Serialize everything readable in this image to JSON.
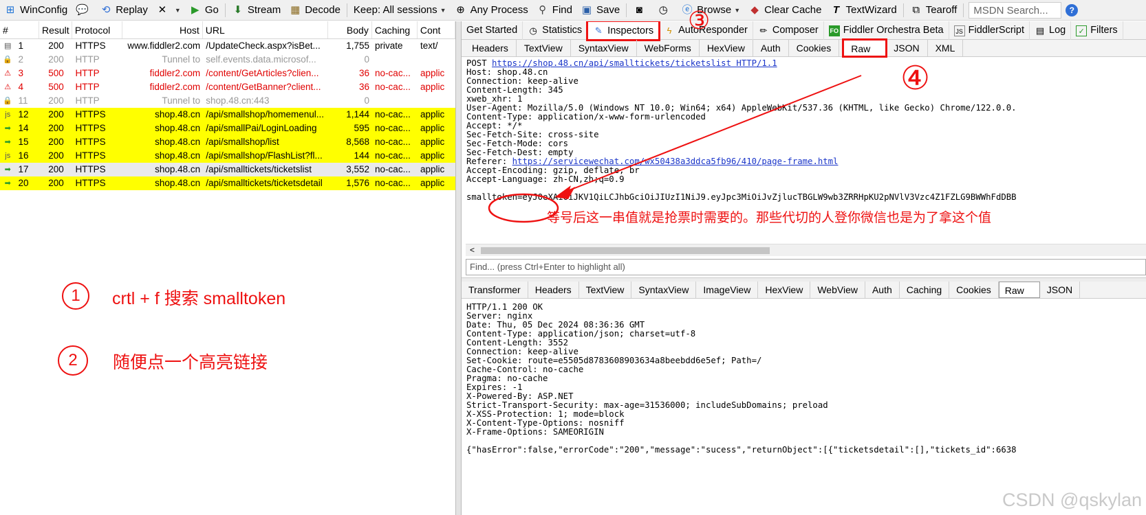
{
  "toolbar": {
    "items": [
      {
        "label": "WinConfig",
        "icon": "windows-icon",
        "dd": false
      },
      {
        "label": "",
        "icon": "comment-icon",
        "dd": false
      },
      {
        "label": "Replay",
        "icon": "replay-icon",
        "dd": false
      },
      {
        "label": "",
        "icon": "remove-icon",
        "dd": true
      },
      {
        "label": "Go",
        "icon": "go-icon",
        "dd": false
      },
      {
        "label": "Stream",
        "icon": "stream-icon",
        "dd": false
      },
      {
        "label": "Decode",
        "icon": "decode-icon",
        "dd": false
      },
      {
        "label": "Keep: All sessions",
        "icon": "",
        "dd": true
      },
      {
        "label": "Any Process",
        "icon": "crosshair-icon",
        "dd": false
      },
      {
        "label": "Find",
        "icon": "binoculars-icon",
        "dd": false
      },
      {
        "label": "Save",
        "icon": "save-icon",
        "dd": false
      },
      {
        "label": "",
        "icon": "camera-icon",
        "dd": false
      },
      {
        "label": "",
        "icon": "timer-icon",
        "dd": false
      },
      {
        "label": "Browse",
        "icon": "ie-icon",
        "dd": true
      },
      {
        "label": "Clear Cache",
        "icon": "eraser-icon",
        "dd": false
      },
      {
        "label": "TextWizard",
        "icon": "text-icon",
        "dd": false
      },
      {
        "label": "Tearoff",
        "icon": "tearoff-icon",
        "dd": false
      }
    ],
    "msdn_placeholder": "MSDN Search..."
  },
  "sessions": {
    "columns": [
      "#",
      "Result",
      "Protocol",
      "Host",
      "URL",
      "Body",
      "Caching",
      "Cont"
    ],
    "rows": [
      {
        "icon": "▤",
        "num": "1",
        "result": "200",
        "protocol": "HTTPS",
        "host": "www.fiddler2.com",
        "url": "/UpdateCheck.aspx?isBet...",
        "body": "1,755",
        "caching": "private",
        "content": "text/",
        "style": ""
      },
      {
        "icon": "🔒",
        "num": "2",
        "result": "200",
        "protocol": "HTTP",
        "host": "Tunnel to",
        "url": "self.events.data.microsof...",
        "body": "0",
        "caching": "",
        "content": "",
        "style": "grey"
      },
      {
        "icon": "⚠",
        "num": "3",
        "result": "500",
        "protocol": "HTTP",
        "host": "fiddler2.com",
        "url": "/content/GetArticles?clien...",
        "body": "36",
        "caching": "no-cac...",
        "content": "applic",
        "style": "red"
      },
      {
        "icon": "⚠",
        "num": "4",
        "result": "500",
        "protocol": "HTTP",
        "host": "fiddler2.com",
        "url": "/content/GetBanner?client...",
        "body": "36",
        "caching": "no-cac...",
        "content": "applic",
        "style": "red"
      },
      {
        "icon": "🔒",
        "num": "11",
        "result": "200",
        "protocol": "HTTP",
        "host": "Tunnel to",
        "url": "shop.48.cn:443",
        "body": "0",
        "caching": "",
        "content": "",
        "style": "grey"
      },
      {
        "icon": "js",
        "num": "12",
        "result": "200",
        "protocol": "HTTPS",
        "host": "shop.48.cn",
        "url": "/api/smallshop/homemenul...",
        "body": "1,144",
        "caching": "no-cac...",
        "content": "applic",
        "style": "yellow"
      },
      {
        "icon": "➡",
        "num": "14",
        "result": "200",
        "protocol": "HTTPS",
        "host": "shop.48.cn",
        "url": "/api/smallPai/LoginLoading",
        "body": "595",
        "caching": "no-cac...",
        "content": "applic",
        "style": "yellow"
      },
      {
        "icon": "➡",
        "num": "15",
        "result": "200",
        "protocol": "HTTPS",
        "host": "shop.48.cn",
        "url": "/api/smallshop/list",
        "body": "8,568",
        "caching": "no-cac...",
        "content": "applic",
        "style": "yellow"
      },
      {
        "icon": "js",
        "num": "16",
        "result": "200",
        "protocol": "HTTPS",
        "host": "shop.48.cn",
        "url": "/api/smallshop/FlashList?fl...",
        "body": "144",
        "caching": "no-cac...",
        "content": "applic",
        "style": "yellow"
      },
      {
        "icon": "➡",
        "num": "17",
        "result": "200",
        "protocol": "HTTPS",
        "host": "shop.48.cn",
        "url": "/api/smalltickets/ticketslist",
        "body": "3,552",
        "caching": "no-cac...",
        "content": "applic",
        "style": "sel"
      },
      {
        "icon": "➡",
        "num": "20",
        "result": "200",
        "protocol": "HTTPS",
        "host": "shop.48.cn",
        "url": "/api/smalltickets/ticketsdetail",
        "body": "1,576",
        "caching": "no-cac...",
        "content": "applic",
        "style": "yellow"
      }
    ]
  },
  "annotations": {
    "n1": "1",
    "t1": "crtl + f 搜索 smalltoken",
    "n2": "2",
    "t2": "随便点一个高亮链接",
    "n3": "③",
    "n4": "④",
    "note": "等号后这一串值就是抢票时需要的。那些代切的人登你微信也是为了拿这个值"
  },
  "top_tabs": [
    {
      "label": "Get Started",
      "icon": ""
    },
    {
      "label": "Statistics",
      "icon": "stopwatch-icon"
    },
    {
      "label": "Inspectors",
      "icon": "inspector-icon"
    },
    {
      "label": "AutoResponder",
      "icon": "lightning-icon"
    },
    {
      "label": "Composer",
      "icon": "pencil-icon"
    },
    {
      "label": "Fiddler Orchestra Beta",
      "icon": "fo-icon"
    },
    {
      "label": "FiddlerScript",
      "icon": "js-icon"
    },
    {
      "label": "Log",
      "icon": "log-icon"
    },
    {
      "label": "Filters",
      "icon": "checkbox-icon"
    }
  ],
  "request_tabs": [
    "Headers",
    "TextView",
    "SyntaxView",
    "WebForms",
    "HexView",
    "Auth",
    "Cookies",
    "Raw",
    "JSON",
    "XML"
  ],
  "request": {
    "l1a": "POST ",
    "l1b": "https://shop.48.cn/api/smalltickets/ticketslist HTTP/1.1",
    "l2": "Host: shop.48.cn",
    "l3": "Connection: keep-alive",
    "l4": "Content-Length: 345",
    "l5": "xweb_xhr: 1",
    "l6": "User-Agent: Mozilla/5.0 (Windows NT 10.0; Win64; x64) AppleWebKit/537.36 (KHTML, like Gecko) Chrome/122.0.0.",
    "l7": "Content-Type: application/x-www-form-urlencoded",
    "l8": "Accept: */*",
    "l9": "Sec-Fetch-Site: cross-site",
    "l10": "Sec-Fetch-Mode: cors",
    "l11": "Sec-Fetch-Dest: empty",
    "l12a": "Referer: ",
    "l12b": "https://servicewechat.com/wx50438a3ddca5fb96/410/page-frame.html",
    "l13": "Accept-Encoding: gzip, deflate, br",
    "l14": "Accept-Language: zh-CN,zh;q=0.9",
    "l16": "smalltoken=eyJ0eXAiOiJKV1QiLCJhbGciOiJIUzI1NiJ9.eyJpc3MiOiJvZjlucTBGLW9wb3ZRRHpKU2pNVlV3Vzc4Z1FZLG9BWWhFdDBB"
  },
  "find_placeholder": "Find... (press Ctrl+Enter to highlight all)",
  "response_tabs": [
    "Transformer",
    "Headers",
    "TextView",
    "SyntaxView",
    "ImageView",
    "HexView",
    "WebView",
    "Auth",
    "Caching",
    "Cookies",
    "Raw",
    "JSON"
  ],
  "response": {
    "r1": "HTTP/1.1 200 OK",
    "r2": "Server: nginx",
    "r3": "Date: Thu, 05 Dec 2024 08:36:36 GMT",
    "r4": "Content-Type: application/json; charset=utf-8",
    "r5": "Content-Length: 3552",
    "r6": "Connection: keep-alive",
    "r7": "Set-Cookie: route=e5505d8783608903634a8beebdd6e5ef; Path=/",
    "r8": "Cache-Control: no-cache",
    "r9": "Pragma: no-cache",
    "r10": "Expires: -1",
    "r11": "X-Powered-By: ASP.NET",
    "r12": "Strict-Transport-Security: max-age=31536000; includeSubDomains; preload",
    "r13": "X-XSS-Protection: 1; mode=block",
    "r14": "X-Content-Type-Options: nosniff",
    "r15": "X-Frame-Options: SAMEORIGIN",
    "r17": "{\"hasError\":false,\"errorCode\":\"200\",\"message\":\"sucess\",\"returnObject\":[{\"ticketsdetail\":[],\"tickets_id\":6638"
  },
  "watermark": "CSDN @qskylan"
}
